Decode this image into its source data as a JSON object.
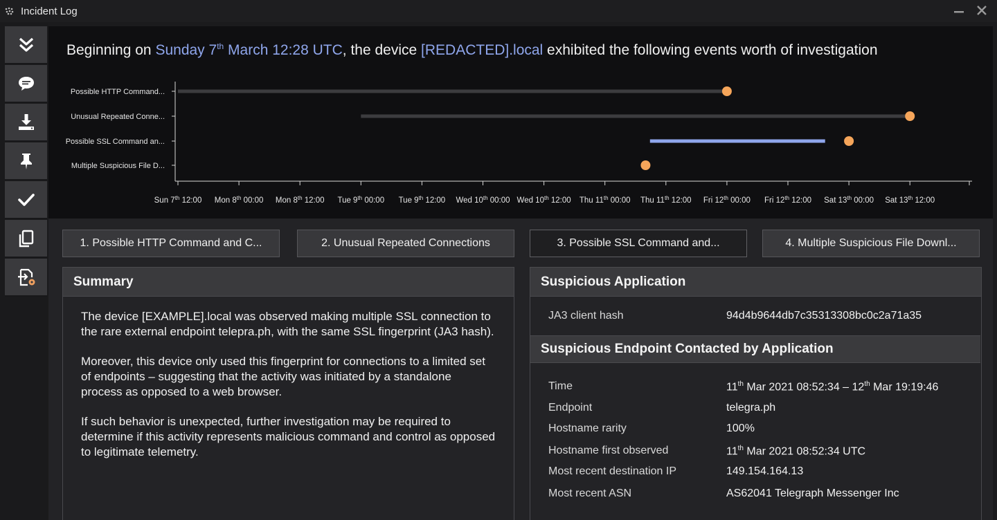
{
  "window": {
    "title": "Incident Log"
  },
  "headline": {
    "prefix": "Beginning on ",
    "date_day": "Sunday 7",
    "date_sup": "th",
    "date_rest": " March 12:28 UTC",
    "middle": ", the device ",
    "device": "[REDACTED].local",
    "suffix": " exhibited the following events worth of investigation"
  },
  "sidebar": {
    "items": [
      {
        "icon": "double-chevron-down-icon"
      },
      {
        "icon": "comment-icon"
      },
      {
        "icon": "download-icon"
      },
      {
        "icon": "pin-icon"
      },
      {
        "icon": "check-icon"
      },
      {
        "icon": "copy-icon"
      },
      {
        "icon": "export-report-icon"
      }
    ]
  },
  "chart_data": {
    "type": "timeline",
    "rows": [
      {
        "label": "Possible HTTP Command...",
        "start": "Sun 7th 12:00",
        "end": "Fri 12th 00:00",
        "marker": "Fri 12th 00:00",
        "bar_color": "#3c3c3f"
      },
      {
        "label": "Unusual Repeated Conne...",
        "start": "Tue 9th 00:00",
        "end": "Sat 13th 12:00",
        "marker": "Sat 13th 12:00",
        "bar_color": "#3c3c3f"
      },
      {
        "label": "Possible SSL Command an...",
        "start": "Thu 11th 08:52",
        "end": "Fri 12th 19:19",
        "marker": "Sat 13th 00:00",
        "bar_color": "#8fa6ec"
      },
      {
        "label": "Multiple Suspicious File D...",
        "start": null,
        "end": null,
        "marker": "Thu 11th 08:00",
        "bar_color": null
      }
    ],
    "x_ticks": [
      {
        "day": "Sun 7",
        "sup": "th",
        "time": " 12:00"
      },
      {
        "day": "Mon 8",
        "sup": "th",
        "time": " 00:00"
      },
      {
        "day": "Mon 8",
        "sup": "th",
        "time": " 12:00"
      },
      {
        "day": "Tue 9",
        "sup": "th",
        "time": " 00:00"
      },
      {
        "day": "Tue 9",
        "sup": "th",
        "time": " 12:00"
      },
      {
        "day": "Wed 10",
        "sup": "th",
        "time": " 00:00"
      },
      {
        "day": "Wed 10",
        "sup": "th",
        "time": " 12:00"
      },
      {
        "day": "Thu 11",
        "sup": "th",
        "time": " 00:00"
      },
      {
        "day": "Thu 11",
        "sup": "th",
        "time": " 12:00"
      },
      {
        "day": "Fri 12",
        "sup": "th",
        "time": " 00:00"
      },
      {
        "day": "Fri 12",
        "sup": "th",
        "time": " 12:00"
      },
      {
        "day": "Sat 13",
        "sup": "th",
        "time": " 00:00"
      },
      {
        "day": "Sat 13",
        "sup": "th",
        "time": " 12:00"
      }
    ],
    "marker_color": "#f5a55a"
  },
  "tabs": [
    {
      "label": "1. Possible HTTP Command and C..."
    },
    {
      "label": "2. Unusual Repeated Connections"
    },
    {
      "label": "3. Possible SSL Command and..."
    },
    {
      "label": "4. Multiple Suspicious File Downl..."
    }
  ],
  "summary": {
    "title": "Summary",
    "paragraphs": [
      "The device [EXAMPLE].local was observed making multiple SSL connection to the rare external endpoint telepra.ph, with the same SSL fingerprint (JA3 hash).",
      "Moreover, this device only used this fingerprint for connections to a limited set of endpoints – suggesting that the activity was initiated by a standalone process as opposed to a web browser.",
      "If such behavior is unexpected, further investigation may be required to determine if this activity represents malicious command and control as opposed to legitimate telemetry."
    ]
  },
  "suspicious_application": {
    "title": "Suspicious Application",
    "ja3_label": "JA3 client hash",
    "ja3_value": "94d4b9644db7c35313308bc0c2a71a35"
  },
  "endpoint": {
    "title": "Suspicious Endpoint Contacted by Application",
    "time_label": "Time",
    "time_a": "11",
    "time_a_sup": "th",
    "time_b": " Mar 2021 08:52:34 – 12",
    "time_b_sup": "th",
    "time_c": " Mar 19:19:46",
    "endpoint_label": "Endpoint",
    "endpoint_value": "telegra.ph",
    "rarity_label": "Hostname rarity",
    "rarity_value": "100%",
    "first_label": "Hostname first observed",
    "first_a": "11",
    "first_a_sup": "th",
    "first_b": " Mar 2021 08:52:34 UTC",
    "ip_label": "Most recent destination IP",
    "ip_value": "149.154.164.13",
    "asn_label": "Most recent ASN",
    "asn_value": "AS62041 Telegraph Messenger Inc"
  }
}
